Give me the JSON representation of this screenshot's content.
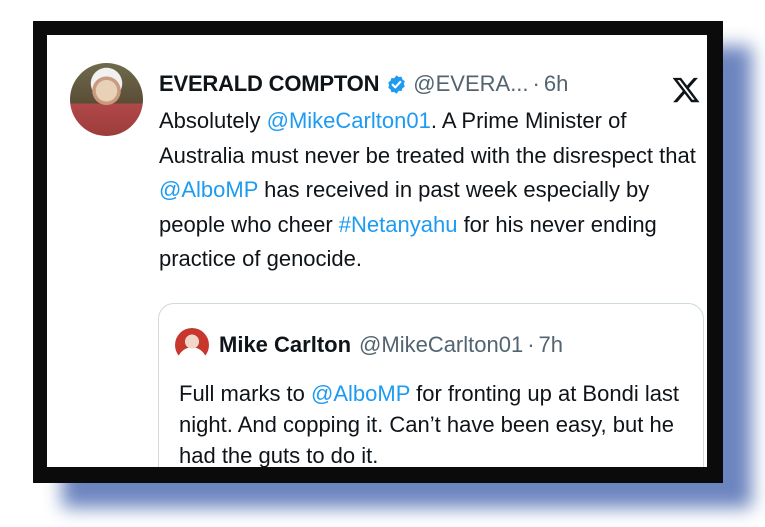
{
  "tweet": {
    "author_name": "EVERALD COMPTON",
    "handle": "@EVERA...",
    "separator": "·",
    "time": "6h",
    "body": [
      {
        "text": "Absolutely ",
        "link": false
      },
      {
        "text": "@MikeCarlton01",
        "link": true
      },
      {
        "text": ".  A Prime Minister of Australia must never be treated with the disrespect that ",
        "link": false
      },
      {
        "text": "@AlboMP",
        "link": true
      },
      {
        "text": " has received in past week especially by people who cheer ",
        "link": false
      },
      {
        "text": "#Netanyahu",
        "link": true
      },
      {
        "text": " for his never ending practice of genocide.",
        "link": false
      }
    ]
  },
  "quoted_tweet": {
    "author_name": "Mike Carlton",
    "handle": "@MikeCarlton01",
    "separator": "·",
    "time": "7h",
    "body": [
      {
        "text": "Full marks to ",
        "link": false
      },
      {
        "text": "@AlboMP",
        "link": true
      },
      {
        "text": " for fronting up at Bondi last night. And copping it.  Can’t have been easy, but he had the guts to do it.",
        "link": false
      }
    ]
  },
  "icons": {
    "verified": "verified-badge-icon",
    "platform": "x-logo-icon"
  },
  "colors": {
    "link": "#1d9bf0",
    "text": "#0f1419",
    "muted": "#536471",
    "frame": "#0b0b0b",
    "shadow": "#5d78b8"
  }
}
